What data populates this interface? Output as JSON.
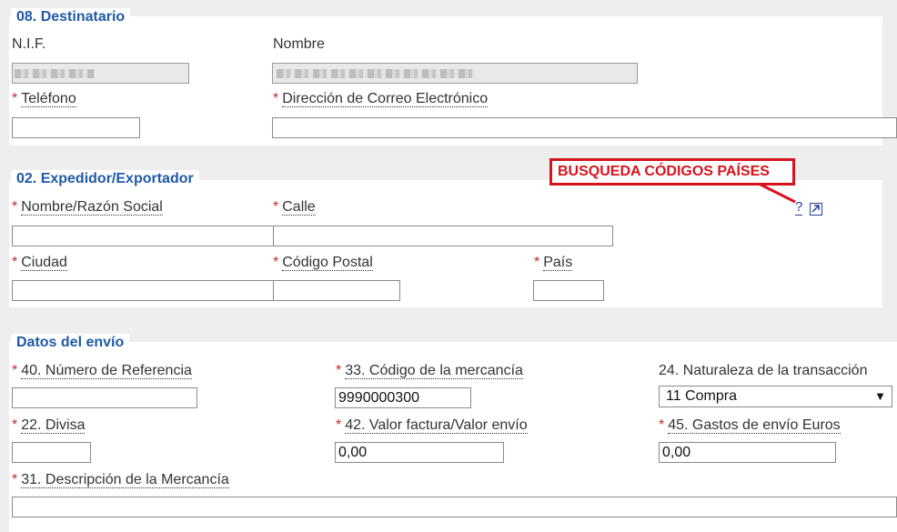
{
  "destinatario": {
    "title": "08. Destinatario",
    "nif_label": "N.I.F.",
    "nombre_label": "Nombre",
    "telefono_label": "Teléfono",
    "email_label": "Dirección de Correo Electrónico"
  },
  "expedidor": {
    "title": "02. Expedidor/Exportador",
    "nombre_label": "Nombre/Razón Social",
    "calle_label": "Calle",
    "ciudad_label": "Ciudad",
    "cp_label": "Código Postal",
    "pais_label": "País"
  },
  "callout": {
    "text": "BUSQUEDA CÓDIGOS PAÍSES",
    "color": "#d7141d"
  },
  "help": {
    "question": "?"
  },
  "envio": {
    "title": "Datos del envío",
    "referencia_label": "40. Número de Referencia",
    "codigo_label": "33. Código de la mercancía",
    "codigo_value": "9990000300",
    "naturaleza_label": "24. Naturaleza de la transacción",
    "naturaleza_value": "11 Compra",
    "divisa_label": "22. Divisa",
    "valor_label": "42. Valor factura/Valor envío",
    "valor_value": "0,00",
    "gastos_label": "45. Gastos de envío Euros",
    "gastos_value": "0,00",
    "descripcion_label": "31. Descripción de la Mercancía"
  },
  "required_marker": "*",
  "colors": {
    "legend": "#1f5aa8",
    "required": "#c62828",
    "panel": "#ffffff",
    "background": "#eeeeee"
  }
}
